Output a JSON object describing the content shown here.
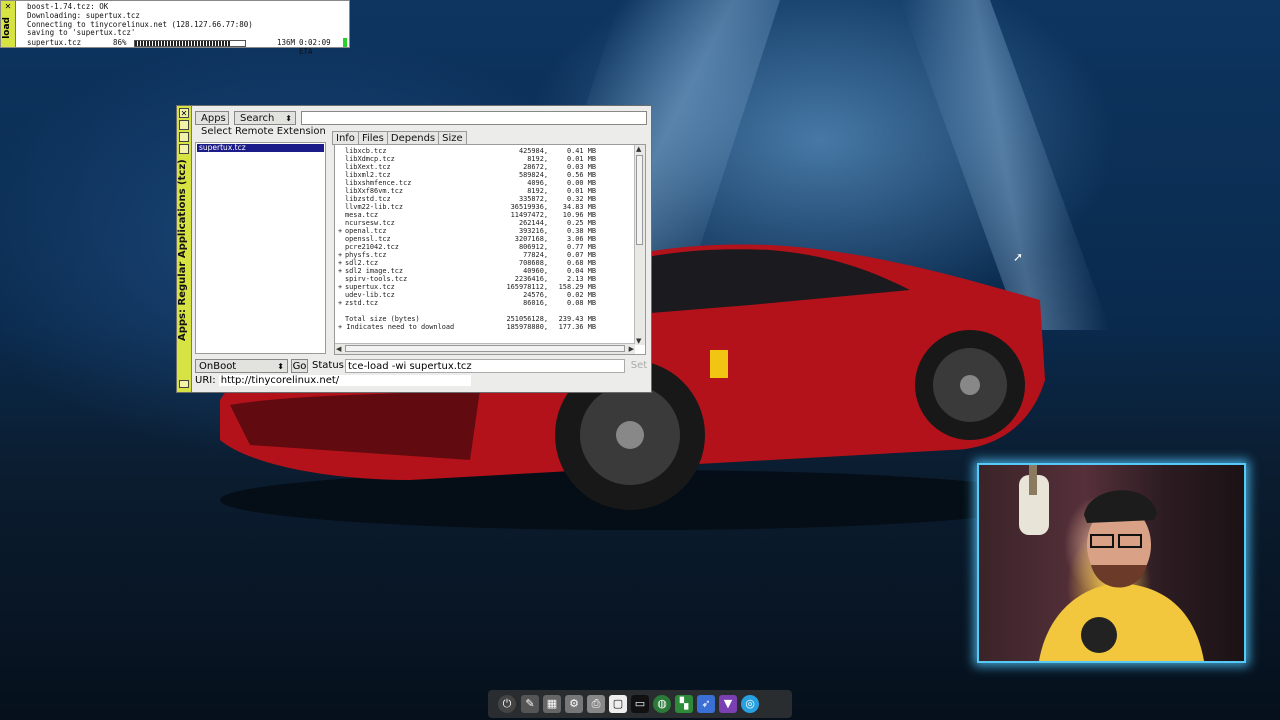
{
  "download_terminal": {
    "side_label": "load",
    "lines": [
      "boost-1.74.tcz: OK",
      "Downloading: supertux.tcz",
      "Connecting to tinycorelinux.net (128.127.66.77:80)",
      "saving to 'supertux.tcz'"
    ],
    "progress": {
      "filename": "supertux.tcz",
      "percent_text": "86%",
      "percent": 86,
      "size": "136M",
      "eta": "0:02:09 ETA"
    }
  },
  "apps_window": {
    "side_title": "Apps: Regular Applications (tcz)",
    "apps_button": "Apps",
    "search_button": "Search",
    "select_label": "Select Remote Extension",
    "selected_extension": "supertux.tcz",
    "tabs": [
      "Info",
      "Files",
      "Depends",
      "Size"
    ],
    "packages": [
      {
        "flag": "",
        "name": "libxcb.tcz",
        "bytes": "425984,",
        "mb": "0.41 MB"
      },
      {
        "flag": "",
        "name": "libXdmcp.tcz",
        "bytes": "8192,",
        "mb": "0.01 MB"
      },
      {
        "flag": "",
        "name": "libXext.tcz",
        "bytes": "28672,",
        "mb": "0.03 MB"
      },
      {
        "flag": "",
        "name": "libxml2.tcz",
        "bytes": "589824,",
        "mb": "0.56 MB"
      },
      {
        "flag": "",
        "name": "libxshmfence.tcz",
        "bytes": "4096,",
        "mb": "0.00 MB"
      },
      {
        "flag": "",
        "name": "libXxf86vm.tcz",
        "bytes": "8192,",
        "mb": "0.01 MB"
      },
      {
        "flag": "",
        "name": "libzstd.tcz",
        "bytes": "335872,",
        "mb": "0.32 MB"
      },
      {
        "flag": "",
        "name": "llvm22-lib.tcz",
        "bytes": "36519936,",
        "mb": "34.83 MB"
      },
      {
        "flag": "",
        "name": "mesa.tcz",
        "bytes": "11497472,",
        "mb": "10.96 MB"
      },
      {
        "flag": "",
        "name": "ncursesw.tcz",
        "bytes": "262144,",
        "mb": "0.25 MB"
      },
      {
        "flag": "+",
        "name": "openal.tcz",
        "bytes": "393216,",
        "mb": "0.38 MB"
      },
      {
        "flag": "",
        "name": "openssl.tcz",
        "bytes": "3207168,",
        "mb": "3.06 MB"
      },
      {
        "flag": "",
        "name": "pcre21042.tcz",
        "bytes": "806912,",
        "mb": "0.77 MB"
      },
      {
        "flag": "+",
        "name": "physfs.tcz",
        "bytes": "77824,",
        "mb": "0.07 MB"
      },
      {
        "flag": "+",
        "name": "sdl2.tcz",
        "bytes": "708608,",
        "mb": "0.68 MB"
      },
      {
        "flag": "+",
        "name": "sdl2 image.tcz",
        "bytes": "40960,",
        "mb": "0.04 MB"
      },
      {
        "flag": "",
        "name": "spirv-tools.tcz",
        "bytes": "2236416,",
        "mb": "2.13 MB"
      },
      {
        "flag": "+",
        "name": "supertux.tcz",
        "bytes": "165978112,",
        "mb": "158.29 MB"
      },
      {
        "flag": "",
        "name": "udev-lib.tcz",
        "bytes": "24576,",
        "mb": "0.02 MB"
      },
      {
        "flag": "+",
        "name": "zstd.tcz",
        "bytes": "86016,",
        "mb": "0.08 MB"
      }
    ],
    "total_label": "Total size (bytes)",
    "total_bytes": "251056128,",
    "total_mb": "239.43 MB",
    "download_label": "+ Indicates need to download",
    "download_bytes": "185978880,",
    "download_mb": "177.36 MB",
    "onboot_select": "OnBoot",
    "go_button": "Go",
    "status_label": "Status",
    "status_value": "tce-load -wi supertux.tcz",
    "set_button": "Set",
    "url_label": "URI:",
    "url_value": "http://tinycorelinux.net/"
  },
  "dock": {
    "icons": [
      "power-icon",
      "paint-brush-icon",
      "control-panel-icon",
      "settings-gear-icon",
      "printer-icon",
      "desktop-icon",
      "terminal-icon",
      "globe-icon",
      "apps-grid-icon",
      "swift-icon",
      "brave-icon",
      "safari-icon"
    ]
  },
  "colors": {
    "side_bar": "#d7e342",
    "selection": "#1b1b8a",
    "webcam_border": "#56c9f6"
  }
}
